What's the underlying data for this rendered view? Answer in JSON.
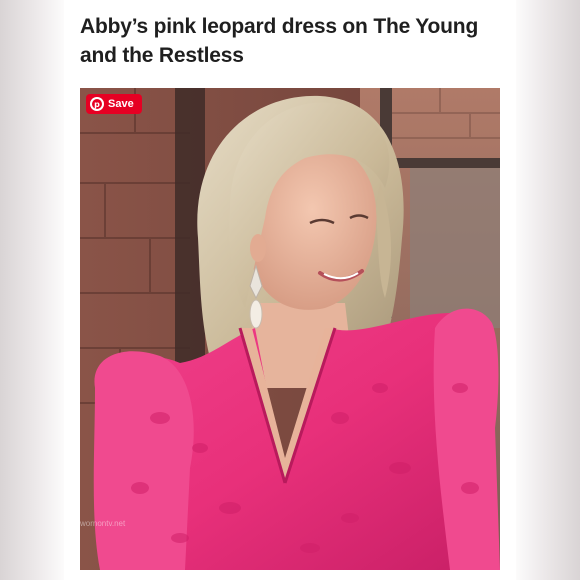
{
  "article": {
    "title": "Abby’s pink leopard dress on The Young and the Restless"
  },
  "photo": {
    "save_button_label": "Save",
    "watermark_text": "wornontv.net"
  },
  "colors": {
    "save_button": "#e60023",
    "dress_pink": "#e8307a"
  }
}
